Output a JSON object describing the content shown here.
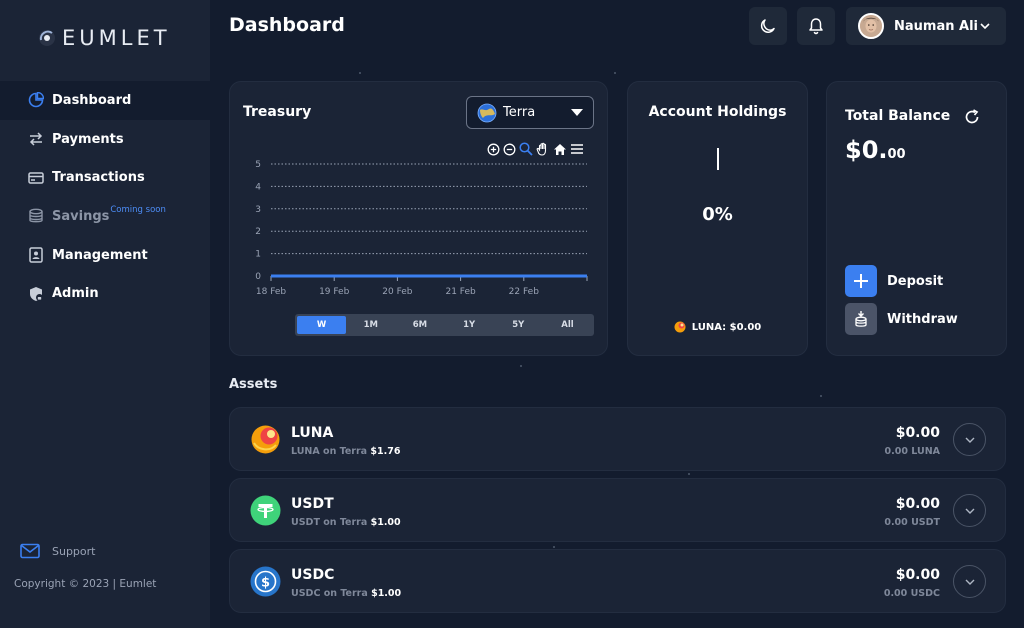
{
  "app": {
    "logo_text": "EUMLET"
  },
  "sidebar": {
    "items": [
      {
        "label": "Dashboard",
        "icon": "pie-chart-icon",
        "active": true
      },
      {
        "label": "Payments",
        "icon": "exchange-arrows-icon"
      },
      {
        "label": "Transactions",
        "icon": "credit-card-icon"
      },
      {
        "label": "Savings",
        "icon": "coins-stack-icon",
        "badge": "Coming soon",
        "disabled": true
      },
      {
        "label": "Management",
        "icon": "id-badge-icon"
      },
      {
        "label": "Admin",
        "icon": "shield-lock-icon"
      }
    ],
    "support_label": "Support",
    "copyright": "Copyright © 2023 | Eumlet"
  },
  "header": {
    "title": "Dashboard",
    "user_name": "Nauman Ali"
  },
  "treasury": {
    "title": "Treasury",
    "network": "Terra",
    "ranges": [
      "W",
      "1M",
      "6M",
      "1Y",
      "5Y",
      "All"
    ],
    "active_range": "W"
  },
  "chart_data": {
    "type": "line",
    "x": [
      "18 Feb",
      "19 Feb",
      "20 Feb",
      "21 Feb",
      "22 Feb"
    ],
    "y_ticks": [
      0,
      1,
      2,
      3,
      4,
      5
    ],
    "values": [
      0,
      0,
      0,
      0,
      0,
      0
    ],
    "ylim": [
      0,
      5
    ],
    "grid": true,
    "color": "#3b7ff0"
  },
  "holdings": {
    "title": "Account Holdings",
    "percent": "0%",
    "legend": "LUNA: $0.00"
  },
  "balance": {
    "title": "Total Balance",
    "amount_main": "$0.",
    "amount_cents": "00",
    "deposit_label": "Deposit",
    "withdraw_label": "Withdraw"
  },
  "assets": {
    "title": "Assets",
    "rows": [
      {
        "name": "LUNA",
        "network": "LUNA on Terra",
        "price": "$1.76",
        "value": "$0.00",
        "qty": "0.00 LUNA"
      },
      {
        "name": "USDT",
        "network": "USDT on Terra",
        "price": "$1.00",
        "value": "$0.00",
        "qty": "0.00 USDT"
      },
      {
        "name": "USDC",
        "network": "USDC on Terra",
        "price": "$1.00",
        "value": "$0.00",
        "qty": "0.00 USDC"
      }
    ]
  },
  "colors": {
    "accent": "#3b7ff0",
    "background": "#131c2e",
    "card": "#1b2436"
  }
}
